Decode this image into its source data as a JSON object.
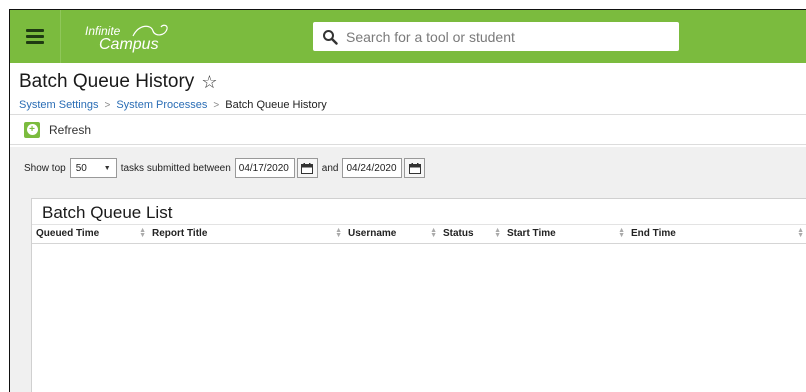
{
  "app": {
    "logo_line1": "Infinite",
    "logo_line2": "Campus",
    "search_placeholder": "Search for a tool or student"
  },
  "page": {
    "title": "Batch Queue History",
    "breadcrumb": [
      "System Settings",
      "System Processes",
      "Batch Queue History"
    ]
  },
  "toolbar": {
    "refresh_label": "Refresh"
  },
  "filter": {
    "show_top_label": "Show top",
    "top_value": "50",
    "between_label": "tasks submitted between",
    "start_date": "04/17/2020",
    "and_label": "and",
    "end_date": "04/24/2020"
  },
  "list": {
    "title": "Batch Queue List",
    "columns": [
      "Queued Time",
      "Report Title",
      "Username",
      "Status",
      "Start Time",
      "End Time"
    ]
  },
  "colors": {
    "brand_green": "#7bbb3e",
    "link_blue": "#2a6db5"
  }
}
